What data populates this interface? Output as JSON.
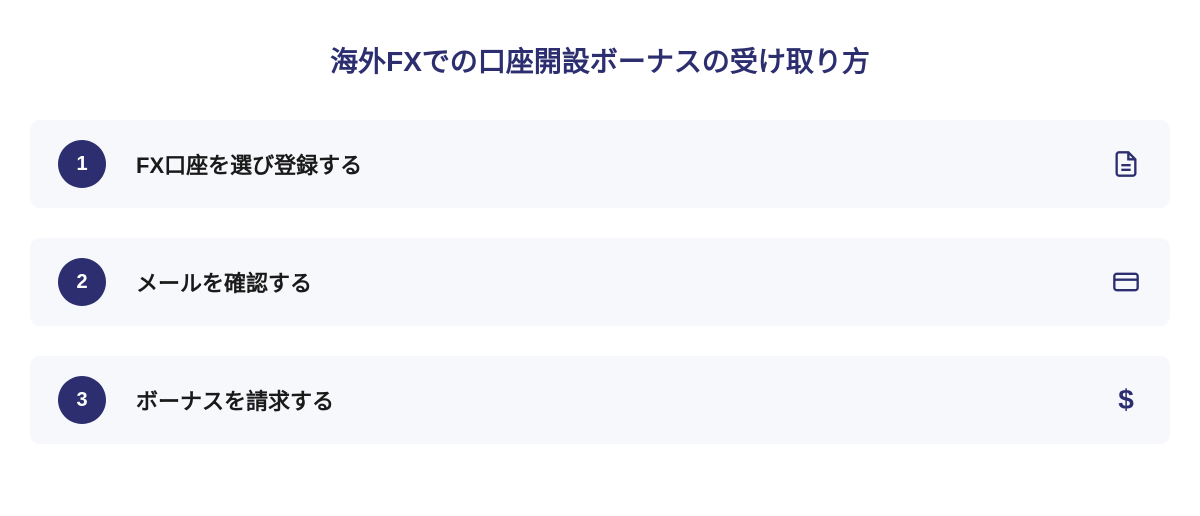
{
  "title": "海外FXでの口座開設ボーナスの受け取り方",
  "steps": [
    {
      "number": "1",
      "label": "FX口座を選び登録する",
      "icon": "document"
    },
    {
      "number": "2",
      "label": "メールを確認する",
      "icon": "card"
    },
    {
      "number": "3",
      "label": "ボーナスを請求する",
      "icon": "dollar"
    }
  ]
}
